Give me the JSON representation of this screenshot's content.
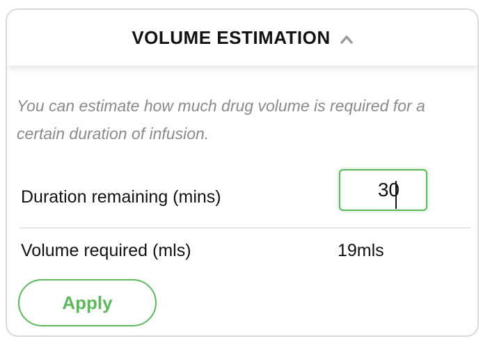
{
  "header": {
    "title": "VOLUME ESTIMATION",
    "toggle_icon": "chevron-up-icon"
  },
  "description": "You can estimate how much drug volume is required for a certain duration of infusion.",
  "duration": {
    "label": "Duration remaining (mins)",
    "value": "30"
  },
  "volume": {
    "label": "Volume required (mls)",
    "value": "19mls"
  },
  "actions": {
    "apply_label": "Apply"
  },
  "colors": {
    "accent_green": "#5cb85c",
    "description_text": "#8a8a8a",
    "border": "#d9d9d9"
  }
}
